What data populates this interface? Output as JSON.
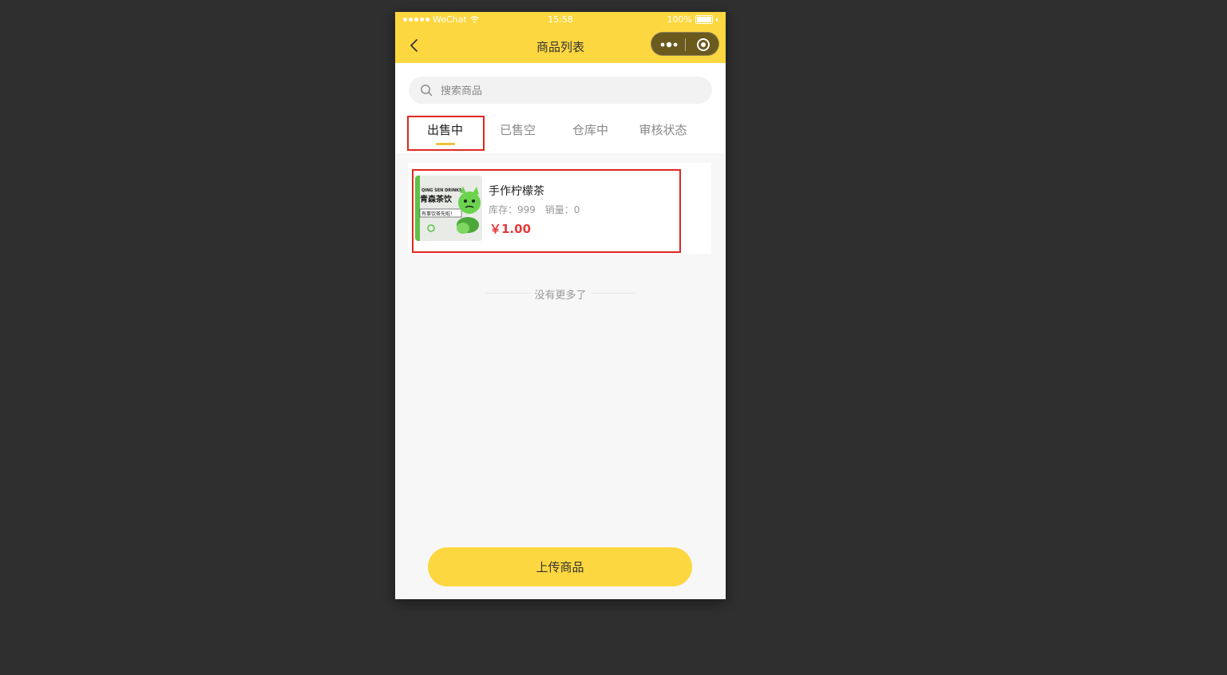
{
  "status_bar": {
    "carrier": "WeChat",
    "time": "15:58",
    "battery": "100%"
  },
  "nav": {
    "title": "商品列表",
    "back_icon": "chevron-left-icon",
    "more_icon": "more-dots-icon",
    "close_icon": "target-circle-icon"
  },
  "search": {
    "placeholder": "搜索商品",
    "value": ""
  },
  "tabs": [
    {
      "label": "出售中",
      "active": true
    },
    {
      "label": "已售空",
      "active": false
    },
    {
      "label": "仓库中",
      "active": false
    },
    {
      "label": "审核状态",
      "active": false
    }
  ],
  "products": [
    {
      "name": "手作柠檬茶",
      "stock_label": "库存：999",
      "sales_label": "销量：0",
      "price": "￥1.00",
      "thumb_text_brand": "QING SEN DRINKS",
      "thumb_text_cn": "青森茶饮",
      "thumb_text_slogan": "有事饮茶先啦！"
    }
  ],
  "list_footer": "没有更多了",
  "upload_button": "上传商品",
  "colors": {
    "brand_yellow": "#fdd73f",
    "price_red": "#e53b3b",
    "highlight_red": "#e0281f",
    "background": "#2f2f2f"
  }
}
